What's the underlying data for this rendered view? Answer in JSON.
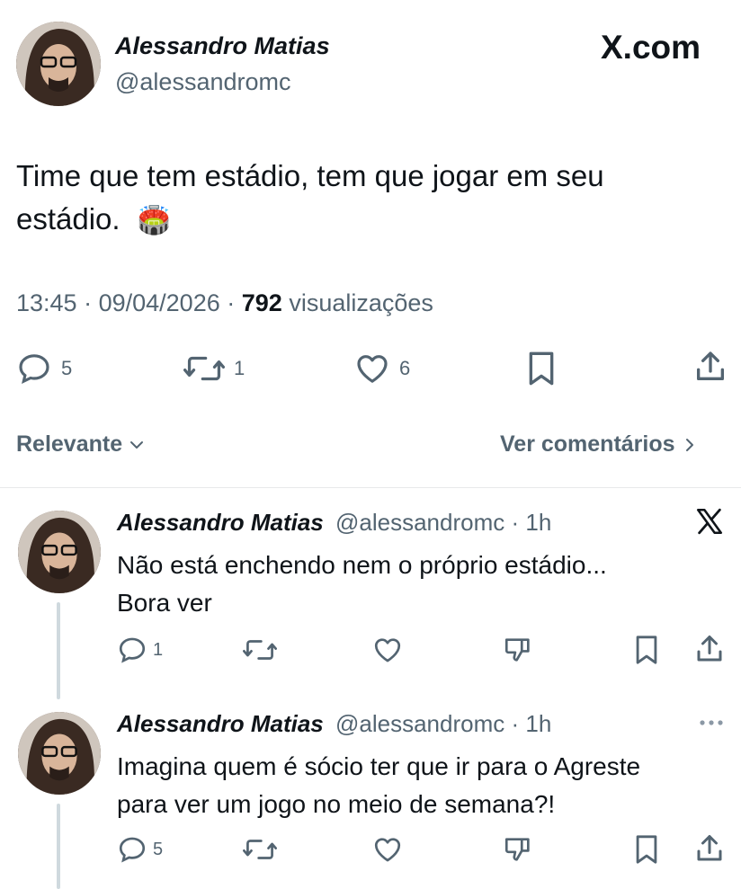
{
  "main_tweet": {
    "author_name": "Alessandro Matias",
    "author_handle": "@alessandromc",
    "brand": "X.com",
    "text_line1": "Time que tem estádio, tem que jogar em seu",
    "text_line2": "estádio.",
    "emoji": "🏟️",
    "time": "13:45",
    "date": "09/04/2026",
    "views_count": "792",
    "views_label": "visualizações",
    "replies": "5",
    "retweets": "1",
    "likes": "6"
  },
  "sort_bar": {
    "sort_label": "Relevante",
    "comments_link": "Ver comentários"
  },
  "replies": [
    {
      "author_name": "Alessandro Matias",
      "author_handle": "@alessandromc",
      "separator": "·",
      "age": "1h",
      "text_line1": "Não está enchendo nem o próprio estádio...",
      "text_line2": "Bora ver",
      "replies": "1"
    },
    {
      "author_name": "Alessandro Matias",
      "author_handle": "@alessandromc",
      "separator": "·",
      "age": "1h",
      "text_line1": "Imagina quem é sócio ter que ir para o Agreste",
      "text_line2": "para ver um jogo no meio de semana?!",
      "replies": "5"
    }
  ],
  "colors": {
    "text": "#0f1419",
    "muted": "#536471",
    "divider": "#e7e9ea"
  }
}
